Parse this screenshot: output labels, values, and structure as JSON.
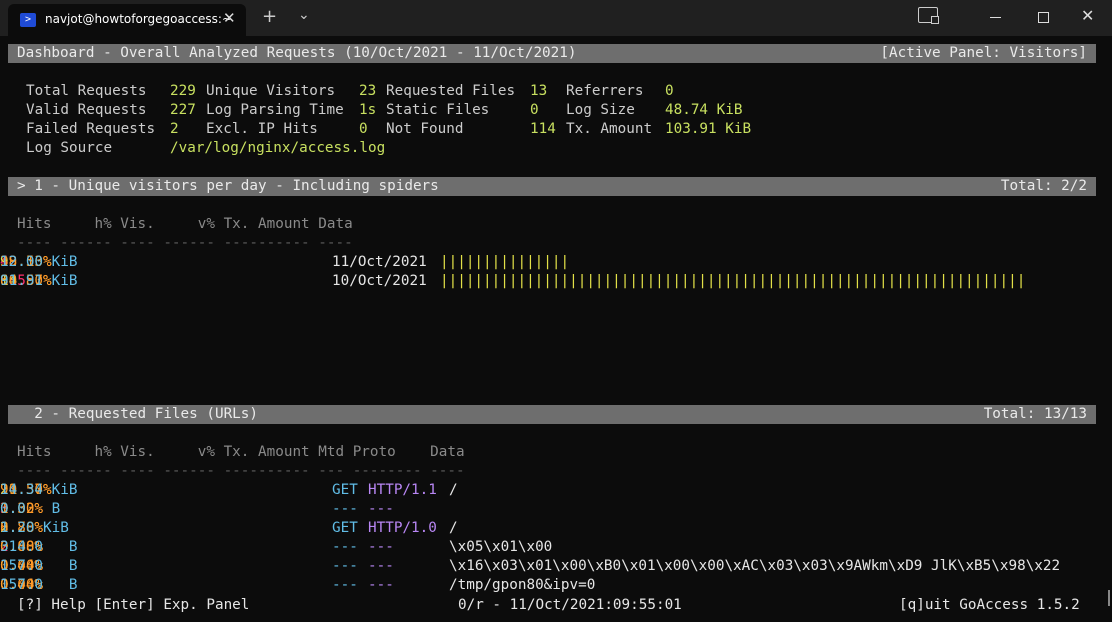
{
  "window": {
    "tab_title": "navjot@howtoforgegoaccess:~",
    "tab_icon": "powershell-icon",
    "close_glyph": "✕",
    "newtab_glyph": "+",
    "dropdown_glyph": "⌄",
    "tb_close_glyph": "✕"
  },
  "dashboard": {
    "header_left": "Dashboard - Overall Analyzed Requests (10/Oct/2021 - 11/Oct/2021)",
    "header_right": "[Active Panel: Visitors]",
    "stats": {
      "total_requests_label": "Total Requests",
      "total_requests": "229",
      "unique_visitors_label": "Unique Visitors",
      "unique_visitors": "23",
      "requested_files_label": "Requested Files",
      "requested_files": "13",
      "referrers_label": "Referrers",
      "referrers": "0",
      "valid_requests_label": "Valid Requests",
      "valid_requests": "227",
      "log_parsing_time_label": "Log Parsing Time",
      "log_parsing_time": "1s",
      "static_files_label": "Static Files",
      "static_files": "0",
      "log_size_label": "Log Size",
      "log_size": "48.74 KiB",
      "failed_requests_label": "Failed Requests",
      "failed_requests": "2",
      "excl_ip_hits_label": "Excl. IP Hits",
      "excl_ip_hits": "0",
      "not_found_label": "Not Found",
      "not_found": "114",
      "tx_amount_label": "Tx. Amount",
      "tx_amount": "103.91 KiB",
      "log_source_label": "Log Source",
      "log_source": "/var/log/nginx/access.log"
    }
  },
  "visitors": {
    "header_left": "> 1 - Unique visitors per day - Including spiders",
    "header_right": "Total: 2/2",
    "columns": "Hits     h% Vis.     v% Tx. Amount Data",
    "rule": "---- ------ ---- ------ ---------- ----",
    "rows": [
      {
        "hits": "42",
        "hpct": "18.50%",
        "vis": "9",
        "vpct": "39.13%",
        "tx": "12.00 KiB",
        "data": "11/Oct/2021",
        "bar": "|||||||||||||||"
      },
      {
        "hits": "185",
        "hpct": "81.50%",
        "vis": "14",
        "vpct": "60.87%",
        "tx": "91.91 KiB",
        "data": "10/Oct/2021",
        "bar": "||||||||||||||||||||||||||||||||||||||||||||||||||||||||||||||||||||"
      }
    ]
  },
  "requested_files": {
    "header_left": "  2 - Requested Files (URLs)",
    "header_right": "Total: 13/13",
    "columns": "Hits     h% Vis.     v% Tx. Amount Mtd Proto    Data",
    "rule": "---- ------ ---- ------ ---------- --- -------- ----",
    "rows": [
      {
        "hits": "24",
        "hpct": "10.57%",
        "vis": "21",
        "vpct": "91.30%",
        "tx": "14.34 KiB",
        "mtd": "GET",
        "proto": "HTTP/1.1",
        "data": "/"
      },
      {
        "hits": "3",
        "hpct": "1.32%",
        "vis": "0",
        "vpct": "0.00%",
        "tx": "0.0   B",
        "mtd": "---",
        "proto": "---",
        "data": ""
      },
      {
        "hits": "2",
        "hpct": "0.88%",
        "vis": "2",
        "vpct": "8.70%",
        "tx": "1.20 KiB",
        "mtd": "GET",
        "proto": "HTTP/1.0",
        "data": "/"
      },
      {
        "hits": "2",
        "hpct": "0.88%",
        "vis": "0",
        "vpct": "0.00%",
        "tx": "314.0   B",
        "mtd": "---",
        "proto": "---",
        "data": "\\x05\\x01\\x00"
      },
      {
        "hits": "1",
        "hpct": "0.44%",
        "vis": "0",
        "vpct": "0.00%",
        "tx": "157.0   B",
        "mtd": "---",
        "proto": "---",
        "data": "\\x16\\x03\\x01\\x00\\xB0\\x01\\x00\\x00\\xAC\\x03\\x03\\x9AWkm\\xD9 JlK\\xB5\\x98\\x22"
      },
      {
        "hits": "1",
        "hpct": "0.44%",
        "vis": "0",
        "vpct": "0.00%",
        "tx": "157.0   B",
        "mtd": "---",
        "proto": "---",
        "data": "/tmp/gpon80&ipv=0"
      }
    ]
  },
  "footer": {
    "left": "[?] Help [Enter] Exp. Panel",
    "middle": "0/r - 11/Oct/2021:09:55:01",
    "right": "[q]uit GoAccess 1.5.2"
  }
}
